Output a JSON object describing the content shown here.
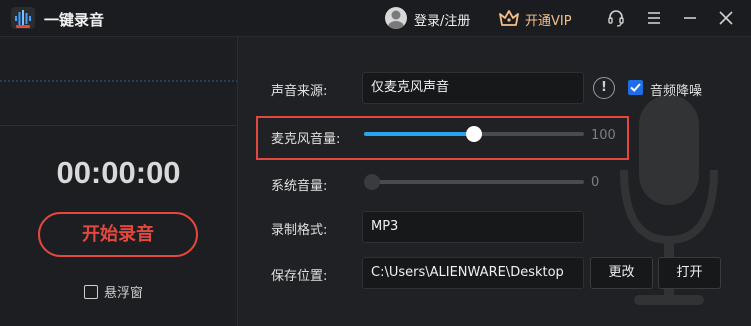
{
  "titlebar": {
    "app_title": "一键录音",
    "login_label": "登录/注册",
    "vip_label": "开通VIP"
  },
  "left": {
    "timer": "00:00:00",
    "start_label": "开始录音",
    "float_label": "悬浮窗"
  },
  "settings": {
    "source_label": "声音来源:",
    "source_value": "仅麦克风声音",
    "noise_label": "音频降噪",
    "noise_checked": true,
    "mic_label": "麦克风音量:",
    "mic_value": "100",
    "mic_level_fraction": 0.5,
    "system_label": "系统音量:",
    "system_value": "0",
    "system_level_fraction": 0.0,
    "format_label": "录制格式:",
    "format_value": "MP3",
    "save_label": "保存位置:",
    "save_path": "C:\\Users\\ALIENWARE\\Desktop",
    "change_label": "更改",
    "open_label": "打开"
  },
  "colors": {
    "accent_red": "#e2483e",
    "slider_blue": "#27a6f0",
    "checkbox_blue": "#1e6ee8",
    "vip_gold": "#f3c08a"
  }
}
